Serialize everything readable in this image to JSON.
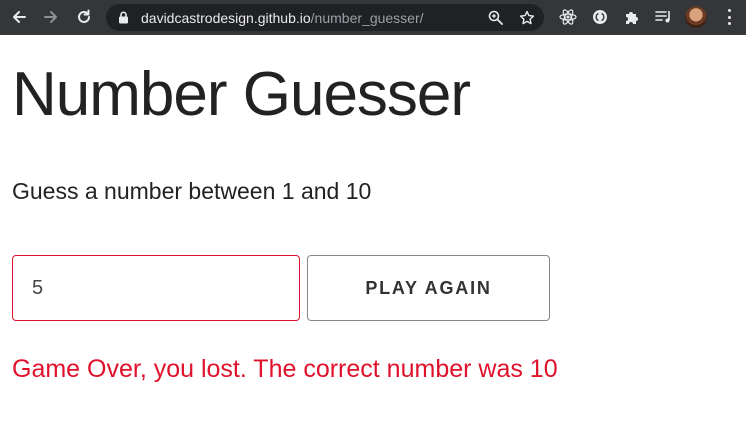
{
  "browser": {
    "url_host": "davidcastrodesign.github.io",
    "url_path": "/number_guesser/",
    "icons": {
      "back": "arrow-left-icon",
      "forward": "arrow-right-icon",
      "reload": "reload-icon",
      "lock": "lock-icon",
      "zoom": "zoom-icon",
      "bookmark": "star-icon",
      "extensions": [
        "react-devtools-icon",
        "circle-extension-icon",
        "puzzle-icon",
        "media-queue-icon"
      ],
      "menu": "kebab-menu-icon"
    }
  },
  "app": {
    "title": "Number Guesser",
    "prompt": "Guess a number between 1 and 10",
    "guess_value": "5",
    "button_label": "PLAY AGAIN",
    "status_message": "Game Over, you lost. The correct number was 10"
  },
  "colors": {
    "error": "#e0112b",
    "text": "#222222",
    "chrome": "#35363a",
    "omnibox": "#202124"
  }
}
